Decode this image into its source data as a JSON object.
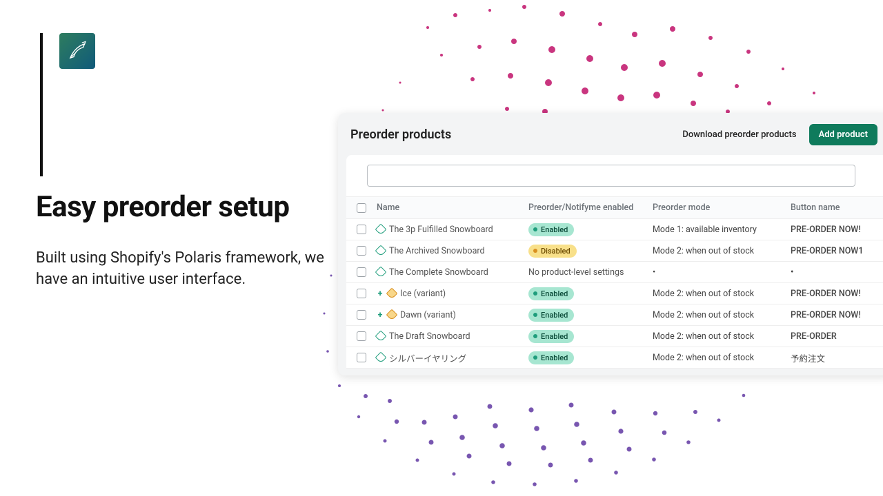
{
  "hero": {
    "headline": "Easy preorder setup",
    "subhead": "Built using Shopify's Polaris framework, we have an intuitive user interface."
  },
  "panel": {
    "title": "Preorder products",
    "download_label": "Download preorder products",
    "add_label": "Add product",
    "columns": {
      "name": "Name",
      "enabled": "Preorder/Notifyme enabled",
      "mode": "Preorder mode",
      "button": "Button name"
    },
    "rows": [
      {
        "name": "The 3p Fulfilled Snowboard",
        "status": "Enabled",
        "status_kind": "enabled",
        "mode": "Mode 1: available inventory",
        "button": "PRE-ORDER NOW!",
        "variant": false
      },
      {
        "name": "The Archived Snowboard",
        "status": "Disabled",
        "status_kind": "disabled",
        "mode": "Mode 2: when out of stock",
        "button": "PRE-ORDER NOW1",
        "variant": false
      },
      {
        "name": "The Complete Snowboard",
        "status_text": "No product-level settings",
        "mode": "•",
        "button": "•",
        "variant": false
      },
      {
        "name": "Ice (variant)",
        "status": "Enabled",
        "status_kind": "enabled",
        "mode": "Mode 2: when out of stock",
        "button": "PRE-ORDER NOW!",
        "variant": true
      },
      {
        "name": "Dawn (variant)",
        "status": "Enabled",
        "status_kind": "enabled",
        "mode": "Mode 2: when out of stock",
        "button": "PRE-ORDER NOW!",
        "variant": true
      },
      {
        "name": "The Draft Snowboard",
        "status": "Enabled",
        "status_kind": "enabled",
        "mode": "Mode 2: when out of stock",
        "button": "PRE-ORDER",
        "variant": false
      },
      {
        "name": "シルバーイヤリング",
        "status": "Enabled",
        "status_kind": "enabled",
        "mode": "Mode 2: when out of stock",
        "button": "予約注文",
        "variant": false
      }
    ]
  },
  "colors": {
    "accent_green": "#0f7b5c",
    "badge_enabled_bg": "#a7e6d1",
    "badge_disabled_bg": "#f8e08a",
    "dots_pink": "#c9357f",
    "dots_purple": "#6b4aa3"
  }
}
